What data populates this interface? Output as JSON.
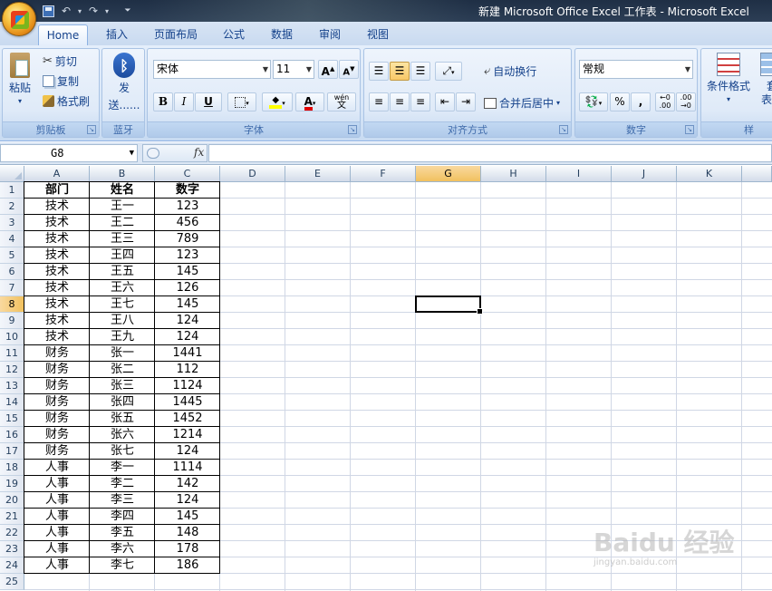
{
  "window": {
    "title": "新建 Microsoft Office Excel 工作表 - Microsoft Excel"
  },
  "tabs": [
    "Home",
    "插入",
    "页面布局",
    "公式",
    "数据",
    "审阅",
    "视图"
  ],
  "ribbon": {
    "clipboard": {
      "label": "剪贴板",
      "paste": "粘贴",
      "cut": "剪切",
      "copy": "复制",
      "format_painter": "格式刷"
    },
    "bluetooth": {
      "label": "蓝牙",
      "send_line1": "发",
      "send_line2": "送......"
    },
    "font": {
      "label": "字体",
      "font_name": "宋体",
      "font_size": "11",
      "grow": "A",
      "shrink": "A",
      "bold": "B",
      "italic": "I",
      "underline": "U",
      "color_letter": "A",
      "wen": "wén",
      "wen_char": "文"
    },
    "alignment": {
      "label": "对齐方式",
      "wrap": "自动换行",
      "merge": "合并后居中"
    },
    "number": {
      "label": "数字",
      "format": "常规",
      "percent": "%",
      "comma": ",",
      "inc_decimal": ".00",
      "dec_decimal": ".00"
    },
    "styles": {
      "conditional": "条件格式",
      "table_line1": "套",
      "table_line2": "表格",
      "label_partial": "样"
    }
  },
  "formula_bar": {
    "name_box": "G8",
    "fx": "fx",
    "content": ""
  },
  "sheet": {
    "columns": [
      "A",
      "B",
      "C",
      "D",
      "E",
      "F",
      "G",
      "H",
      "I",
      "J",
      "K"
    ],
    "selected_column": "G",
    "selected_row": 8,
    "selected_cell": "G8",
    "row_numbers": [
      "1",
      "2",
      "3",
      "4",
      "5",
      "6",
      "7",
      "8",
      "9",
      "10",
      "11",
      "12",
      "13",
      "14",
      "15",
      "16",
      "17",
      "18",
      "19",
      "20",
      "21",
      "22",
      "23",
      "24",
      "25"
    ],
    "header": [
      "部门",
      "姓名",
      "数字"
    ],
    "rows": [
      [
        "技术",
        "王一",
        "123"
      ],
      [
        "技术",
        "王二",
        "456"
      ],
      [
        "技术",
        "王三",
        "789"
      ],
      [
        "技术",
        "王四",
        "123"
      ],
      [
        "技术",
        "王五",
        "145"
      ],
      [
        "技术",
        "王六",
        "126"
      ],
      [
        "技术",
        "王七",
        "145"
      ],
      [
        "技术",
        "王八",
        "124"
      ],
      [
        "技术",
        "王九",
        "124"
      ],
      [
        "财务",
        "张一",
        "1441"
      ],
      [
        "财务",
        "张二",
        "112"
      ],
      [
        "财务",
        "张三",
        "1124"
      ],
      [
        "财务",
        "张四",
        "1445"
      ],
      [
        "财务",
        "张五",
        "1452"
      ],
      [
        "财务",
        "张六",
        "1214"
      ],
      [
        "财务",
        "张七",
        "124"
      ],
      [
        "人事",
        "李一",
        "1114"
      ],
      [
        "人事",
        "李二",
        "142"
      ],
      [
        "人事",
        "李三",
        "124"
      ],
      [
        "人事",
        "李四",
        "145"
      ],
      [
        "人事",
        "李五",
        "148"
      ],
      [
        "人事",
        "李六",
        "178"
      ],
      [
        "人事",
        "李七",
        "186"
      ]
    ]
  },
  "watermark": {
    "main": "Baidu 经验",
    "sub": "jingyan.baidu.com"
  }
}
